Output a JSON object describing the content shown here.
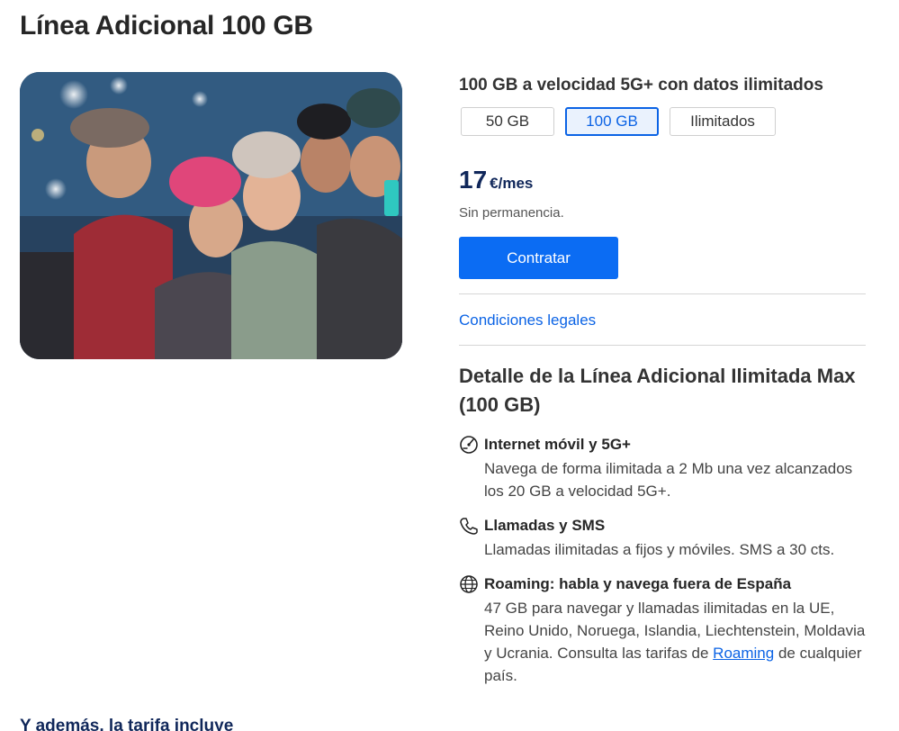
{
  "page": {
    "title": "Línea Adicional 100 GB"
  },
  "plan": {
    "speed_title": "100 GB a velocidad 5G+ con datos ilimitados",
    "options": [
      {
        "label": "50 GB",
        "selected": false
      },
      {
        "label": "100 GB",
        "selected": true
      },
      {
        "label": "Ilimitados",
        "selected": false
      }
    ],
    "price_amount": "17",
    "price_unit": "€/mes",
    "permanence": "Sin permanencia.",
    "cta_label": "Contratar",
    "legal_link": "Condiciones legales"
  },
  "details": {
    "title": "Detalle de la Línea Adicional Ilimitada Max (100 GB)",
    "features": [
      {
        "icon": "speedometer-icon",
        "title": "Internet móvil y 5G+",
        "description": "Navega de forma ilimitada a 2 Mb una vez alcanzados los 20 GB a velocidad 5G+."
      },
      {
        "icon": "phone-icon",
        "title": "Llamadas y SMS",
        "description": "Llamadas ilimitadas a fijos y móviles. SMS a 30 cts."
      },
      {
        "icon": "globe-icon",
        "title": "Roaming: habla y navega fuera de España",
        "description_pre": "47 GB para navegar y llamadas ilimitadas en la UE, Reino Unido, Noruega, Islandia, Liechtenstein, Moldavia y Ucrania. Consulta las tarifas de ",
        "link": "Roaming",
        "description_post": " de cualquier país."
      }
    ]
  },
  "footer": {
    "heading": "Y además, la tarifa incluye"
  },
  "colors": {
    "accent": "#0b6cf3",
    "link": "#0b63e5",
    "price": "#10275a"
  }
}
